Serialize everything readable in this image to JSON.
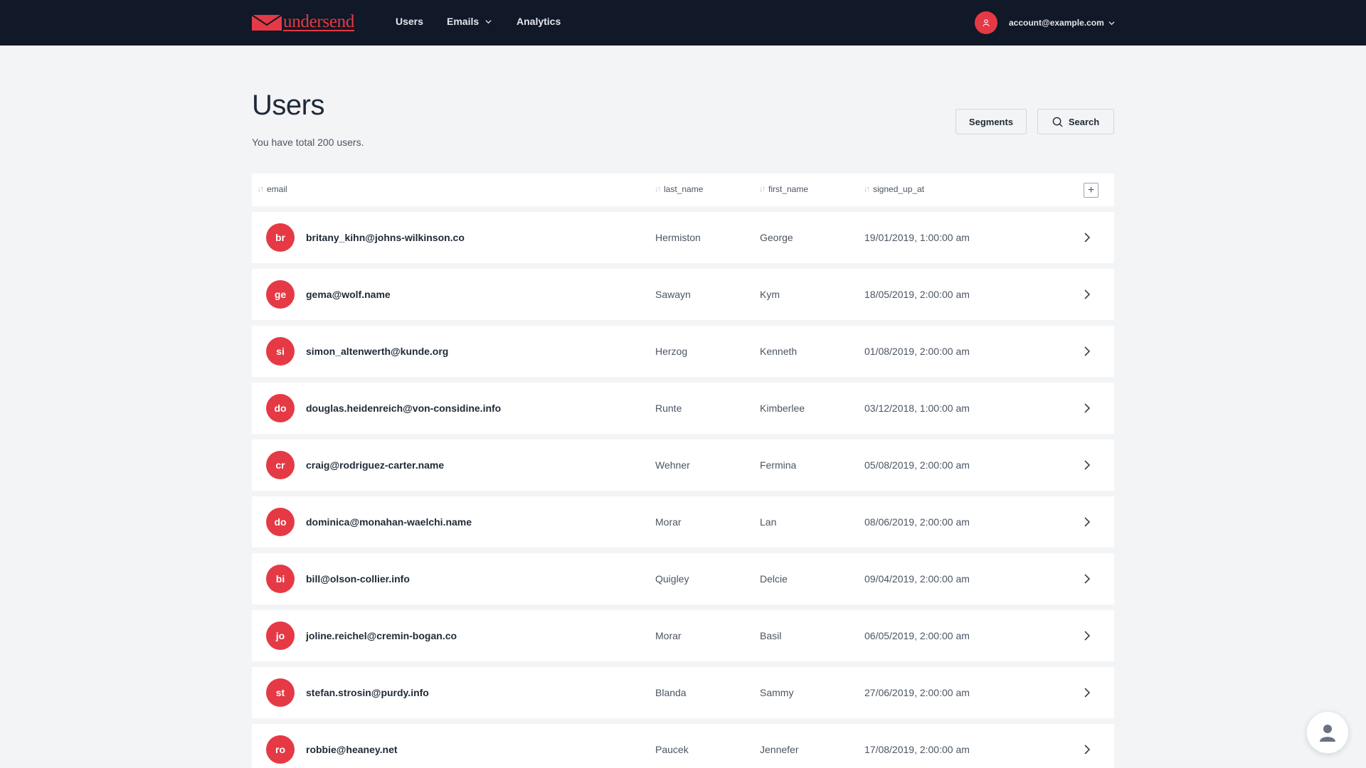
{
  "brand": {
    "name": "undersend",
    "accent": "#e53945"
  },
  "nav": {
    "users": "Users",
    "emails": "Emails",
    "analytics": "Analytics"
  },
  "account": {
    "email": "account@example.com"
  },
  "page": {
    "title": "Users",
    "subtitle": "You have total 200 users.",
    "segments_label": "Segments",
    "search_label": "Search"
  },
  "table": {
    "columns": [
      "email",
      "last_name",
      "first_name",
      "signed_up_at"
    ],
    "add_column_label": "+",
    "rows": [
      {
        "initials": "br",
        "email": "britany_kihn@johns-wilkinson.co",
        "last_name": "Hermiston",
        "first_name": "George",
        "signed_up_at": "19/01/2019, 1:00:00 am"
      },
      {
        "initials": "ge",
        "email": "gema@wolf.name",
        "last_name": "Sawayn",
        "first_name": "Kym",
        "signed_up_at": "18/05/2019, 2:00:00 am"
      },
      {
        "initials": "si",
        "email": "simon_altenwerth@kunde.org",
        "last_name": "Herzog",
        "first_name": "Kenneth",
        "signed_up_at": "01/08/2019, 2:00:00 am"
      },
      {
        "initials": "do",
        "email": "douglas.heidenreich@von-considine.info",
        "last_name": "Runte",
        "first_name": "Kimberlee",
        "signed_up_at": "03/12/2018, 1:00:00 am"
      },
      {
        "initials": "cr",
        "email": "craig@rodriguez-carter.name",
        "last_name": "Wehner",
        "first_name": "Fermina",
        "signed_up_at": "05/08/2019, 2:00:00 am"
      },
      {
        "initials": "do",
        "email": "dominica@monahan-waelchi.name",
        "last_name": "Morar",
        "first_name": "Lan",
        "signed_up_at": "08/06/2019, 2:00:00 am"
      },
      {
        "initials": "bi",
        "email": "bill@olson-collier.info",
        "last_name": "Quigley",
        "first_name": "Delcie",
        "signed_up_at": "09/04/2019, 2:00:00 am"
      },
      {
        "initials": "jo",
        "email": "joline.reichel@cremin-bogan.co",
        "last_name": "Morar",
        "first_name": "Basil",
        "signed_up_at": "06/05/2019, 2:00:00 am"
      },
      {
        "initials": "st",
        "email": "stefan.strosin@purdy.info",
        "last_name": "Blanda",
        "first_name": "Sammy",
        "signed_up_at": "27/06/2019, 2:00:00 am"
      },
      {
        "initials": "ro",
        "email": "robbie@heaney.net",
        "last_name": "Paucek",
        "first_name": "Jennefer",
        "signed_up_at": "17/08/2019, 2:00:00 am"
      }
    ]
  },
  "icons": {
    "logo": "envelope-icon",
    "nav_dropdown": "chevron-down-icon",
    "account": "user-icon",
    "search": "search-icon",
    "sort": "sort-icon",
    "row_action": "chevron-right-icon",
    "chat": "chat-avatar-icon"
  }
}
